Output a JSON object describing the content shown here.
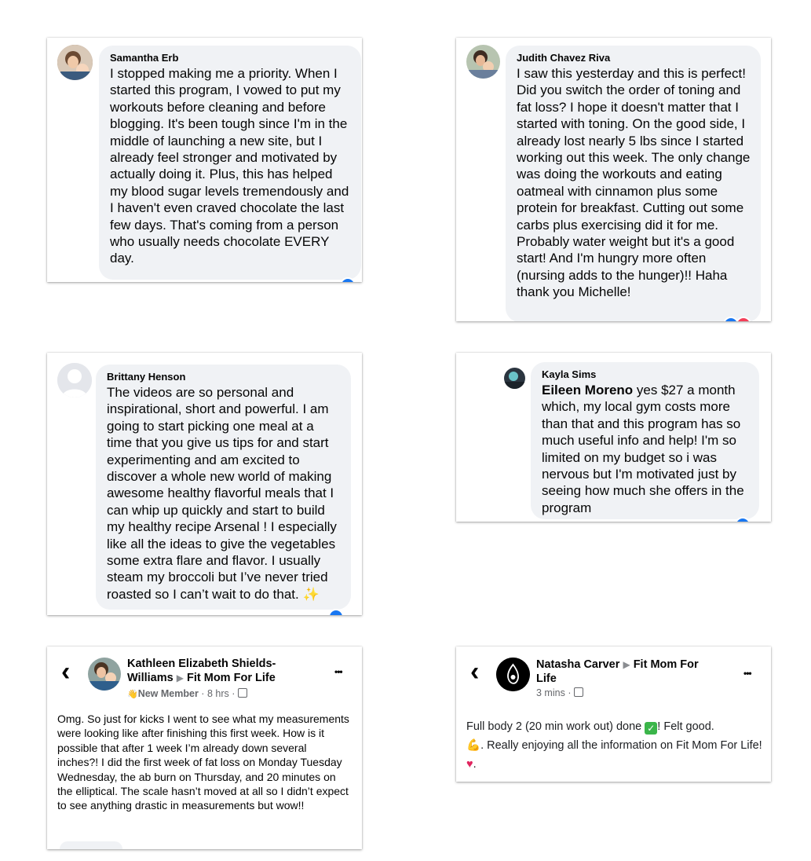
{
  "comments": [
    {
      "author": "Samantha Erb",
      "text": "I stopped making me a priority. When I started this program, I vowed to put my workouts before cleaning and before blogging. It's been tough since I'm in the middle of launching a new site, but I already feel stronger and motivated by actually doing it. Plus, this has helped my blood sugar levels tremendously and I haven't even craved chocolate the last few days. That's coming from a person who usually needs chocolate EVERY day."
    },
    {
      "author": "Judith Chavez Riva",
      "text": "I saw this yesterday and this is perfect! Did you switch the order of toning and fat loss? I hope it doesn't matter that I started with toning. On the good side, I already lost nearly 5 lbs since I started working out this week. The only change was doing the workouts and eating oatmeal with cinnamon plus some protein for breakfast. Cutting out some carbs plus exercising did it for me. Probably water weight but it's a good start! And I'm hungry more often (nursing adds to the hunger)!! Haha thank you Michelle!"
    },
    {
      "author": "Brittany Henson",
      "text": "The videos are so personal and inspirational, short and powerful. I am going to start picking one meal at a time that you give us tips for and start experimenting and am excited to discover a whole new world of making awesome healthy flavorful meals that I can whip up quickly  and start to build my healthy recipe Arsenal ! I especially like all the ideas to give the vegetables some extra flare and flavor. I usually steam my broccoli but I’ve never tried roasted so I can’t wait to do that.",
      "emoji": "✨"
    },
    {
      "author": "Kayla Sims",
      "mention": "Eileen Moreno",
      "text": " yes $27 a month which, my local gym costs more than that and this program has so much useful info and help! I'm so limited on my budget so i was nervous but I'm motivated just by seeing how much she offers in the program"
    }
  ],
  "posts": [
    {
      "author": "Kathleen Elizabeth Shields-Williams",
      "arrow": "▶",
      "group": "Fit Mom For Life",
      "badge_icon": "👋",
      "badge": "New Member",
      "time": "8 hrs",
      "sep": "·",
      "text": "Omg.  So just for kicks I went to see what my measurements were looking like after finishing this first week.  How is it possible that after 1 week I’m already down several inches?!  I did the first week of fat loss on Monday Tuesday Wednesday, the ab burn on Thursday, and 20 minutes on the elliptical.  The scale hasn’t moved at all so I didn’t expect to see anything drastic in measurements but wow!!",
      "back": "‹",
      "more": "•••"
    },
    {
      "author": "Natasha Carver",
      "arrow": "▶",
      "group": "Fit Mom For Life",
      "time": "3 mins",
      "sep": "·",
      "text_a": "Full body 2 (20 min work out) done ",
      "check": "✓",
      "text_b": "!  Felt good.",
      "muscle": "💪",
      "text_c": ". Really enjoying all the information on Fit Mom For Life! ",
      "heart": "♥",
      "text_d": ".",
      "back": "‹",
      "more": "•••"
    }
  ],
  "colors": {
    "bubble": "#f0f2f5",
    "like": "#1877f2",
    "love": "#f33e58",
    "meta": "#65676b"
  }
}
